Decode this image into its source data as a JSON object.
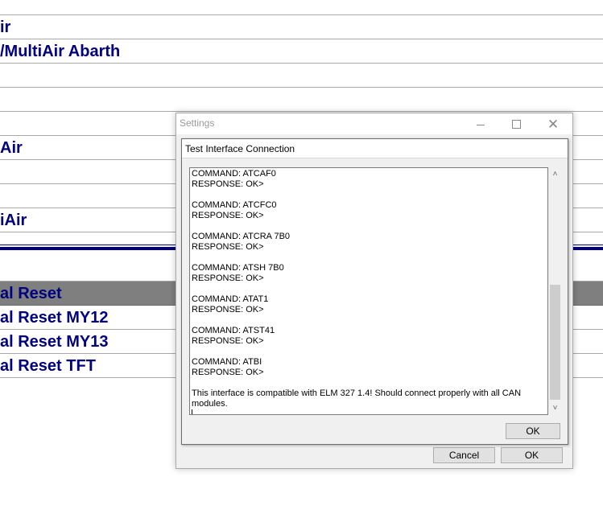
{
  "background_list": {
    "rows": [
      {
        "label": "ir"
      },
      {
        "label": "/MultiAir Abarth"
      },
      {
        "label": ""
      },
      {
        "label": ""
      },
      {
        "label": ""
      },
      {
        "label": "Air"
      },
      {
        "label": ""
      },
      {
        "label": ""
      },
      {
        "label": "iAir"
      },
      {
        "label": ""
      }
    ],
    "reset_rows": [
      {
        "label": "al Reset",
        "selected": true
      },
      {
        "label": "al Reset MY12",
        "selected": false
      },
      {
        "label": "al Reset MY13",
        "selected": false
      },
      {
        "label": "al Reset TFT",
        "selected": false
      }
    ]
  },
  "settings_window": {
    "title": "Settings",
    "cancel_label": "Cancel",
    "ok_label": "OK",
    "controls": {
      "minimize": "minimize-icon",
      "maximize": "maximize-icon",
      "close": "close-icon"
    }
  },
  "test_dialog": {
    "title": "Test Interface Connection",
    "log": "COMMAND: ATCAF0\nRESPONSE: OK>\n\nCOMMAND: ATCFC0\nRESPONSE: OK>\n\nCOMMAND: ATCRA 7B0\nRESPONSE: OK>\n\nCOMMAND: ATSH 7B0\nRESPONSE: OK>\n\nCOMMAND: ATAT1\nRESPONSE: OK>\n\nCOMMAND: ATST41\nRESPONSE: OK>\n\nCOMMAND: ATBI\nRESPONSE: OK>\n\nThis interface is compatible with ELM 327 1.4! Should connect properly with all CAN modules.",
    "ok_label": "OK"
  },
  "colors": {
    "list_text": "#00007f",
    "selected_row": "#7f7f7f",
    "divider": "#00007f"
  }
}
